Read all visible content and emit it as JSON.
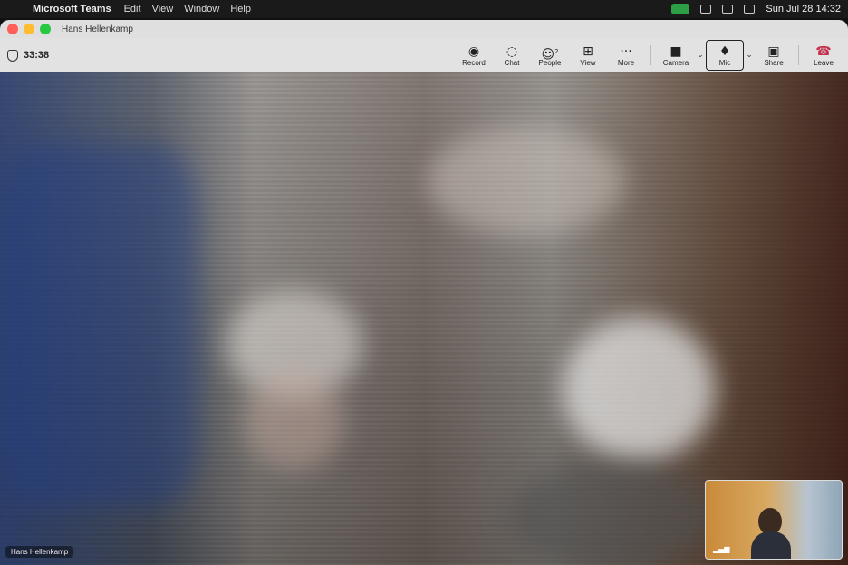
{
  "menubar": {
    "app_name": "Microsoft Teams",
    "menu_items": [
      "Edit",
      "View",
      "Window",
      "Help"
    ],
    "clock": "Sun Jul 28 14:32"
  },
  "window": {
    "title": "Hans Hellenkamp"
  },
  "toolbar": {
    "timer": "33:38",
    "record_label": "Record",
    "chat_label": "Chat",
    "people_label": "People",
    "people_count": "2",
    "view_label": "View",
    "more_label": "More",
    "camera_label": "Camera",
    "mic_label": "Mic",
    "share_label": "Share",
    "leave_label": "Leave"
  },
  "stage": {
    "participant_name": "Hans Hellenkamp"
  },
  "icons": {
    "record": "record-icon",
    "chat": "chat-icon",
    "people": "people-icon",
    "view": "grid-icon",
    "more": "ellipsis-icon",
    "camera": "camera-icon",
    "mic": "mic-icon",
    "share": "share-icon",
    "leave": "phone-hangup-icon"
  },
  "colors": {
    "leave": "#c4314b",
    "video_indicator": "#2e9e44"
  }
}
